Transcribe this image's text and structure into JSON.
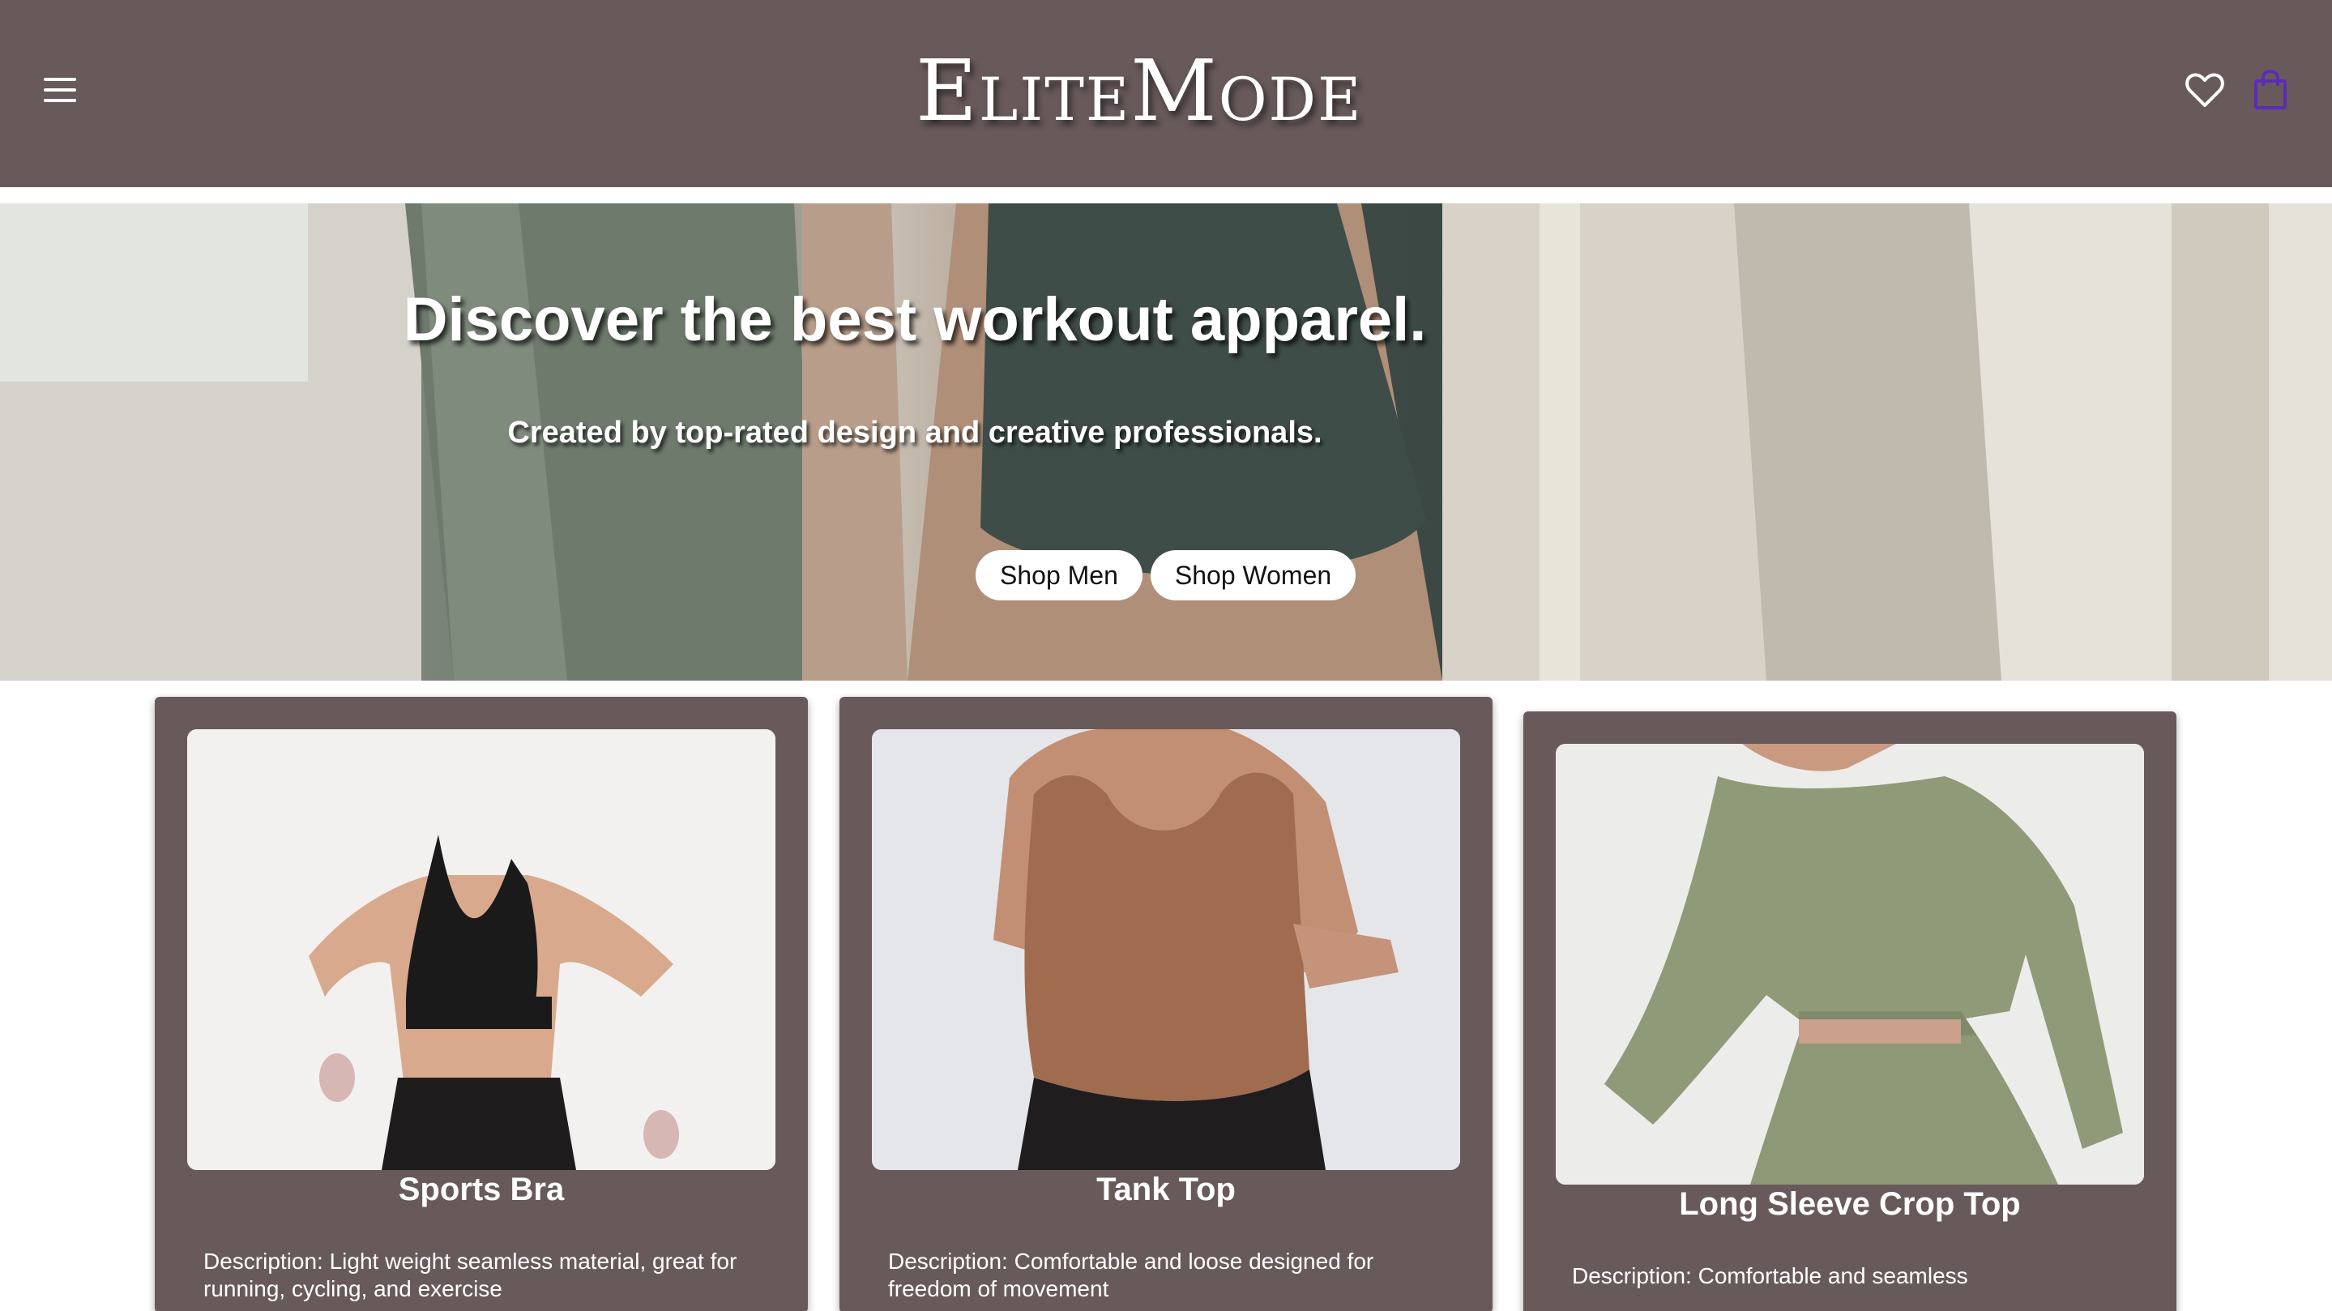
{
  "header": {
    "logo": "EliteMode",
    "menu_icon": "hamburger-menu-icon",
    "wishlist_icon": "heart-icon",
    "cart_icon": "shopping-bag-icon",
    "colors": {
      "background": "#685a5b",
      "cart_icon": "#5b2bb8"
    }
  },
  "hero": {
    "title": "Discover the best workout apparel.",
    "subtitle": "Created by top-rated design and creative professionals.",
    "buttons": [
      "Shop Men",
      "Shop Women"
    ]
  },
  "products": [
    {
      "title": "Sports Bra",
      "description": "Description: Light weight seamless material, great for running, cycling, and exercise",
      "image_color": "#1b1a1a"
    },
    {
      "title": "Tank Top",
      "description": "Description: Comfortable and loose designed for freedom of movement",
      "image_color": "#9a6a4d"
    },
    {
      "title": "Long Sleeve Crop Top",
      "description": "Description: Comfortable and seamless",
      "image_color": "#8f9a78"
    }
  ]
}
